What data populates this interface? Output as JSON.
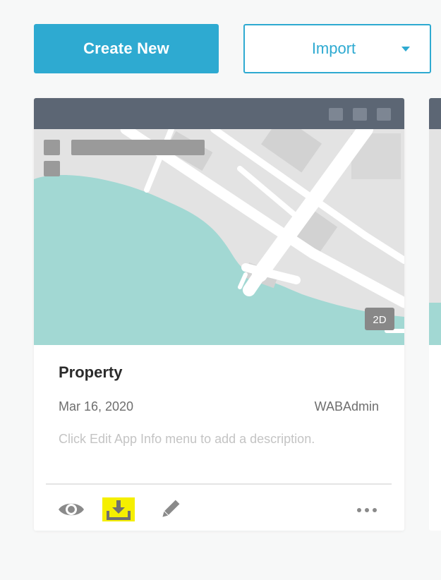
{
  "toolbar": {
    "create_label": "Create New",
    "import_label": "Import"
  },
  "card": {
    "title": "Property",
    "date": "Mar 16, 2020",
    "owner": "WABAdmin",
    "description": "Click Edit App Info menu to add a description.",
    "thumbnail_badge": "2D",
    "actions": [
      "eye-icon",
      "download-icon",
      "pencil-icon",
      "more-icon"
    ]
  },
  "colors": {
    "accent": "#2eaad1",
    "highlight": "#f5ef00",
    "thumb_header": "#5c6674",
    "water": "#a2d8d3",
    "land": "#e3e3e3"
  }
}
